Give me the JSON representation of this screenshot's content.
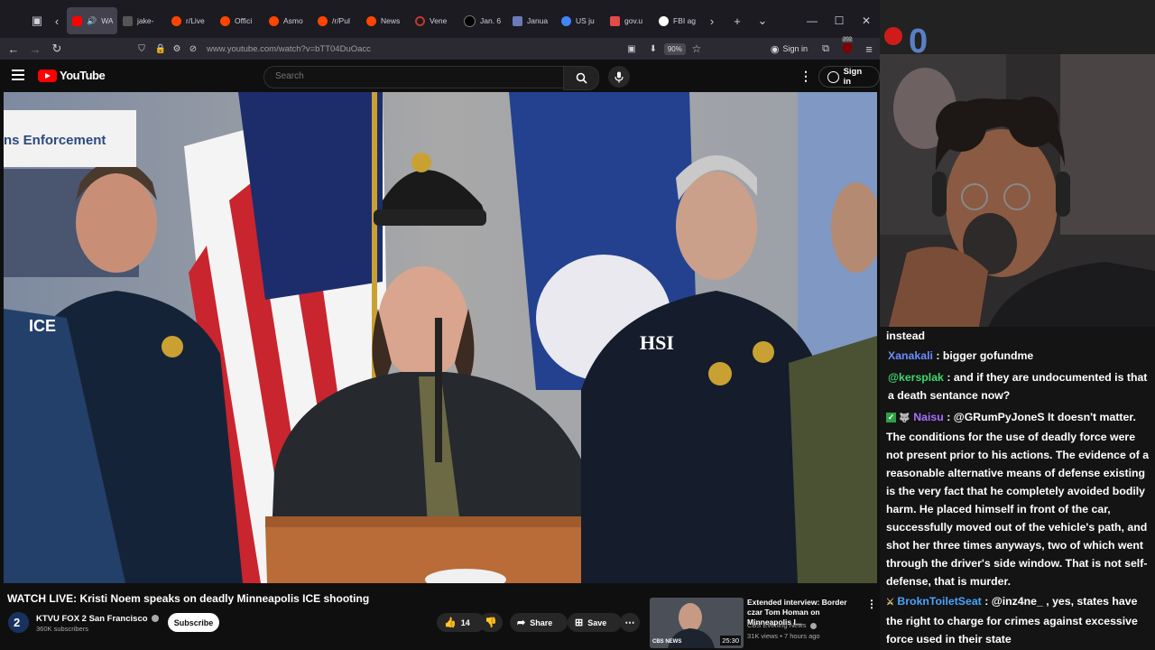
{
  "browser": {
    "tabs": [
      {
        "label": "WA",
        "favicon": "youtube-icon",
        "color": "#ff0000",
        "active": true
      },
      {
        "label": "jake-",
        "favicon": "site-icon",
        "color": "#777777"
      },
      {
        "label": "r/Live",
        "favicon": "reddit-icon",
        "color": "#ff4500"
      },
      {
        "label": "Offici",
        "favicon": "reddit-icon",
        "color": "#ff4500"
      },
      {
        "label": "Asmo",
        "favicon": "reddit-icon",
        "color": "#ff4500"
      },
      {
        "label": "/r/Pul",
        "favicon": "reddit-icon",
        "color": "#ff4500"
      },
      {
        "label": "News",
        "favicon": "reddit-icon",
        "color": "#ff4500"
      },
      {
        "label": "Vene",
        "favicon": "circle-icon",
        "color": "#c0392b"
      },
      {
        "label": "Jan. 6",
        "favicon": "abc-icon",
        "color": "#000000"
      },
      {
        "label": "Janua",
        "favicon": "building-icon",
        "color": "#6b7bb8"
      },
      {
        "label": "US ju",
        "favicon": "google-icon",
        "color": "#4285f4"
      },
      {
        "label": "gov.u",
        "favicon": "pdf-icon",
        "color": "#e34a4a"
      },
      {
        "label": "FBI ag",
        "favicon": "a-icon",
        "color": "#ffffff"
      }
    ],
    "url": "www.youtube.com/watch?v=bTT04DuOacc",
    "zoom": "90%",
    "signin_label": "Sign in",
    "badge_count": "202"
  },
  "youtube": {
    "logo_text": "YouTube",
    "search_placeholder": "Search",
    "signin_label": "Sign in",
    "video_banner_text": "ns Enforcement",
    "video_title": "WATCH LIVE: Kristi Noem speaks on deadly Minneapolis ICE shooting",
    "channel_name": "KTVU FOX 2 San Francisco",
    "channel_subs": "360K subscribers",
    "subscribe_label": "Subscribe",
    "like_count": "14",
    "share_label": "Share",
    "save_label": "Save",
    "recommended": {
      "title": "Extended interview: Border czar Tom Homan on Minneapolis I...",
      "channel": "CBS Evening News",
      "meta": "31K views • 7 hours ago",
      "duration": "25:30",
      "thumb_logo": "CBS NEWS"
    }
  },
  "chat": {
    "messages": [
      {
        "user": "",
        "text": "instead"
      },
      {
        "user": "Xanakali",
        "color": "#6b8cff",
        "text": "bigger gofundme"
      },
      {
        "user": "@kersplak",
        "color": "#3fd66b",
        "text": "and if they are undocumented is that a death sentance now?"
      },
      {
        "user": "Naisu",
        "color": "#a970ff",
        "text": "@GRumPyJoneS It doesn't matter. The conditions for the use of deadly force were not present prior to his actions. The evidence of a reasonable alternative means of defense existing is the very fact that he completely avoided bodily harm. He placed himself in front of the car, successfully moved out of the vehicle's path, and shot her three times anyways, two of which went through the driver's side window. That is not self-defense, that is murder."
      },
      {
        "user": "BroknToiletSeat",
        "color": "#4aa3ff",
        "text": "@inz4ne_ , yes, states have the right to charge for crimes against excessive force used in their state"
      }
    ]
  }
}
